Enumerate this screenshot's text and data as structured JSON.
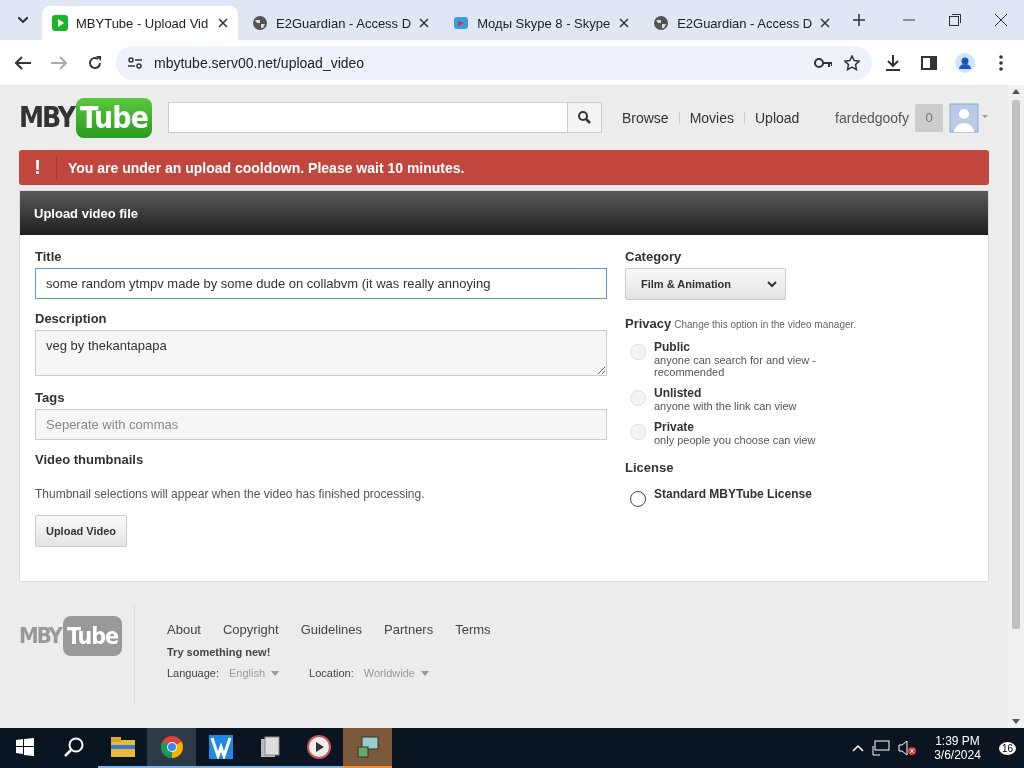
{
  "browser": {
    "tabs": [
      {
        "title": "MBYTube - Upload Vid",
        "kind": "play",
        "selected": true
      },
      {
        "title": "E2Guardian - Access D",
        "kind": "globe",
        "selected": false
      },
      {
        "title": "Моды Skype 8 - Skype",
        "kind": "skype",
        "selected": false
      },
      {
        "title": "E2Guardian - Access D",
        "kind": "globe",
        "selected": false
      }
    ],
    "url": "mbytube.serv00.net/upload_video"
  },
  "header": {
    "logo": {
      "left": "MBY",
      "right": "Tube"
    },
    "nav": [
      "Browse",
      "Movies",
      "Upload"
    ],
    "username": "fardedgoofy",
    "count": "0"
  },
  "alert": {
    "mark": "!",
    "message": "You are under an upload cooldown. Please wait 10 minutes."
  },
  "panel": {
    "title": "Upload video file",
    "title_field": {
      "label": "Title",
      "value": "some random ytmpv made by some dude on collabvm (it was really annoying"
    },
    "description": {
      "label": "Description",
      "value": "veg by thekantapapa"
    },
    "tags": {
      "label": "Tags",
      "placeholder": "Seperate with commas"
    },
    "thumbnails": {
      "label": "Video thumbnails",
      "note": "Thumbnail selections will appear when the video has finished processing."
    },
    "submit": "Upload Video",
    "category": {
      "label": "Category",
      "value": "Film & Animation"
    },
    "privacy": {
      "label": "Privacy",
      "hint": "Change this option in the video manager.",
      "options": [
        {
          "title": "Public",
          "note": "anyone can search for and view - recommended",
          "selected": false,
          "disabled": true
        },
        {
          "title": "Unlisted",
          "note": "anyone with the link can view",
          "selected": false,
          "disabled": true
        },
        {
          "title": "Private",
          "note": "only people you choose can view",
          "selected": false,
          "disabled": true
        }
      ]
    },
    "license": {
      "label": "License",
      "options": [
        {
          "title": "Standard MBYTube License",
          "selected": false,
          "disabled": false
        }
      ]
    }
  },
  "footer": {
    "logo": {
      "left": "MBY",
      "right": "Tube"
    },
    "links": [
      "About",
      "Copyright",
      "Guidelines",
      "Partners",
      "Terms"
    ],
    "tagline": "Try something new!",
    "language": {
      "label": "Language:",
      "value": "English"
    },
    "location": {
      "label": "Location:",
      "value": "Worldwide"
    }
  },
  "taskbar": {
    "apps": [
      {
        "kind": "folder",
        "selected": false,
        "running": true
      },
      {
        "kind": "chrome",
        "selected": true,
        "running": true
      },
      {
        "kind": "editor",
        "selected": false,
        "running": true
      },
      {
        "kind": "files",
        "selected": false,
        "running": true
      },
      {
        "kind": "media",
        "selected": false,
        "running": true
      },
      {
        "kind": "installer",
        "selected": false,
        "running": true,
        "attention": true
      }
    ],
    "time": "1:39 PM",
    "date": "3/6/2024",
    "notifications": "16"
  }
}
